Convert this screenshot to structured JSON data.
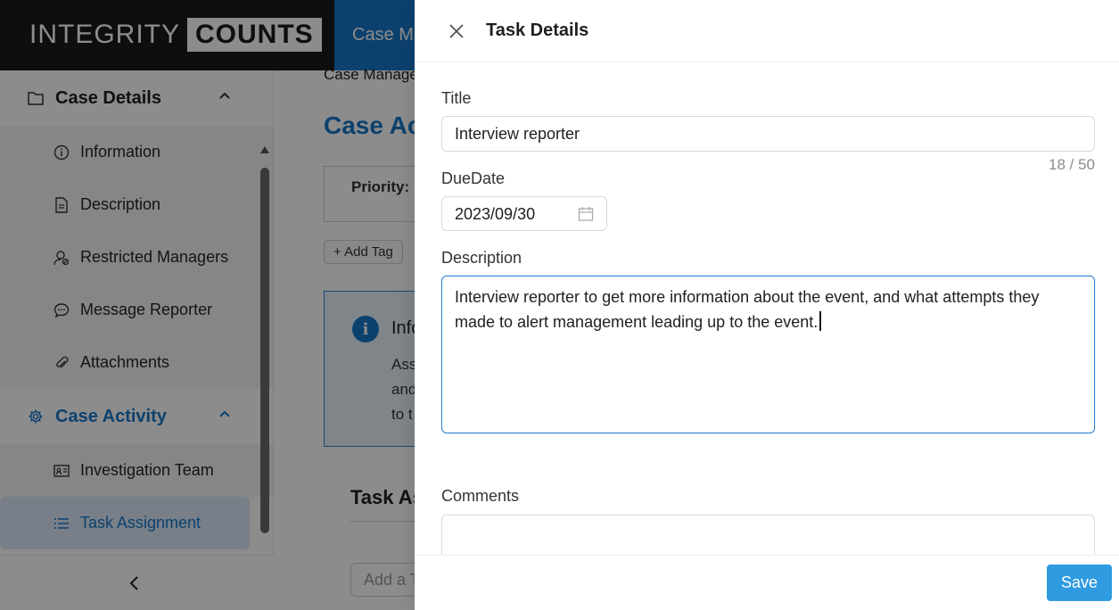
{
  "app": {
    "logo_part1": "INTEGRITY",
    "logo_part2": "COUNTS",
    "top_tab": "Case Ma",
    "accent_color": "#1677c9"
  },
  "sidebar": {
    "group_case_details": "Case Details",
    "items_case_details": [
      {
        "label": "Information",
        "icon": "info-icon"
      },
      {
        "label": "Description",
        "icon": "document-icon"
      },
      {
        "label": "Restricted Managers",
        "icon": "user-restricted-icon"
      },
      {
        "label": "Message Reporter",
        "icon": "chat-icon"
      },
      {
        "label": "Attachments",
        "icon": "paperclip-icon"
      }
    ],
    "group_case_activity": "Case Activity",
    "items_case_activity": [
      {
        "label": "Investigation Team",
        "icon": "id-card-icon"
      },
      {
        "label": "Task Assignment",
        "icon": "list-icon"
      }
    ]
  },
  "content": {
    "breadcrumb": "Case Manage",
    "title": "Case Act",
    "priority": "Priority: N",
    "add_tag": "+ Add Tag",
    "info_title": "Info",
    "info_lines": [
      "Ass",
      "and",
      "to t"
    ],
    "task_heading": "Task As",
    "add_task_placeholder": "Add a T"
  },
  "drawer": {
    "title": "Task Details",
    "title_label": "Title",
    "title_value": "Interview reporter",
    "title_counter": "18 / 50",
    "due_label": "DueDate",
    "due_value": "2023/09/30",
    "description_label": "Description",
    "description_value": "Interview reporter to get more information about the event, and what attempts they made to alert management leading up to the event.",
    "comments_label": "Comments",
    "save_label": "Save"
  }
}
